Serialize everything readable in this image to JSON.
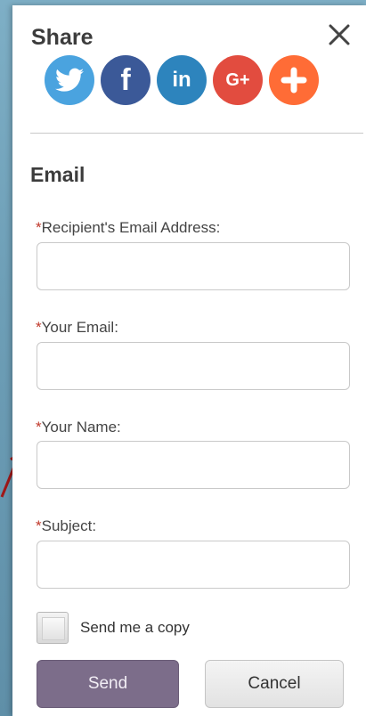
{
  "share": {
    "title": "Share",
    "networks": [
      {
        "name": "twitter-icon"
      },
      {
        "name": "facebook-icon",
        "glyph": "f"
      },
      {
        "name": "linkedin-icon",
        "glyph": "in"
      },
      {
        "name": "google-plus-icon",
        "glyph": "G+"
      },
      {
        "name": "add-more-icon"
      }
    ]
  },
  "email": {
    "heading": "Email",
    "required_marker": "*",
    "fields": [
      {
        "label": "Recipient's Email Address:",
        "value": "",
        "placeholder": ""
      },
      {
        "label": "Your Email:",
        "value": "",
        "placeholder": ""
      },
      {
        "label": "Your Name:",
        "value": "",
        "placeholder": ""
      },
      {
        "label": "Subject:",
        "value": "",
        "placeholder": ""
      }
    ],
    "copy_label": "Send me a copy",
    "send_label": "Send",
    "cancel_label": "Cancel"
  },
  "colors": {
    "send": "#7c6d8a",
    "twitter": "#4aa3df",
    "facebook": "#3b5998",
    "linkedin": "#2d84bd",
    "google_plus": "#e24c3f",
    "more": "#ff6c36",
    "required": "#c0392b"
  }
}
